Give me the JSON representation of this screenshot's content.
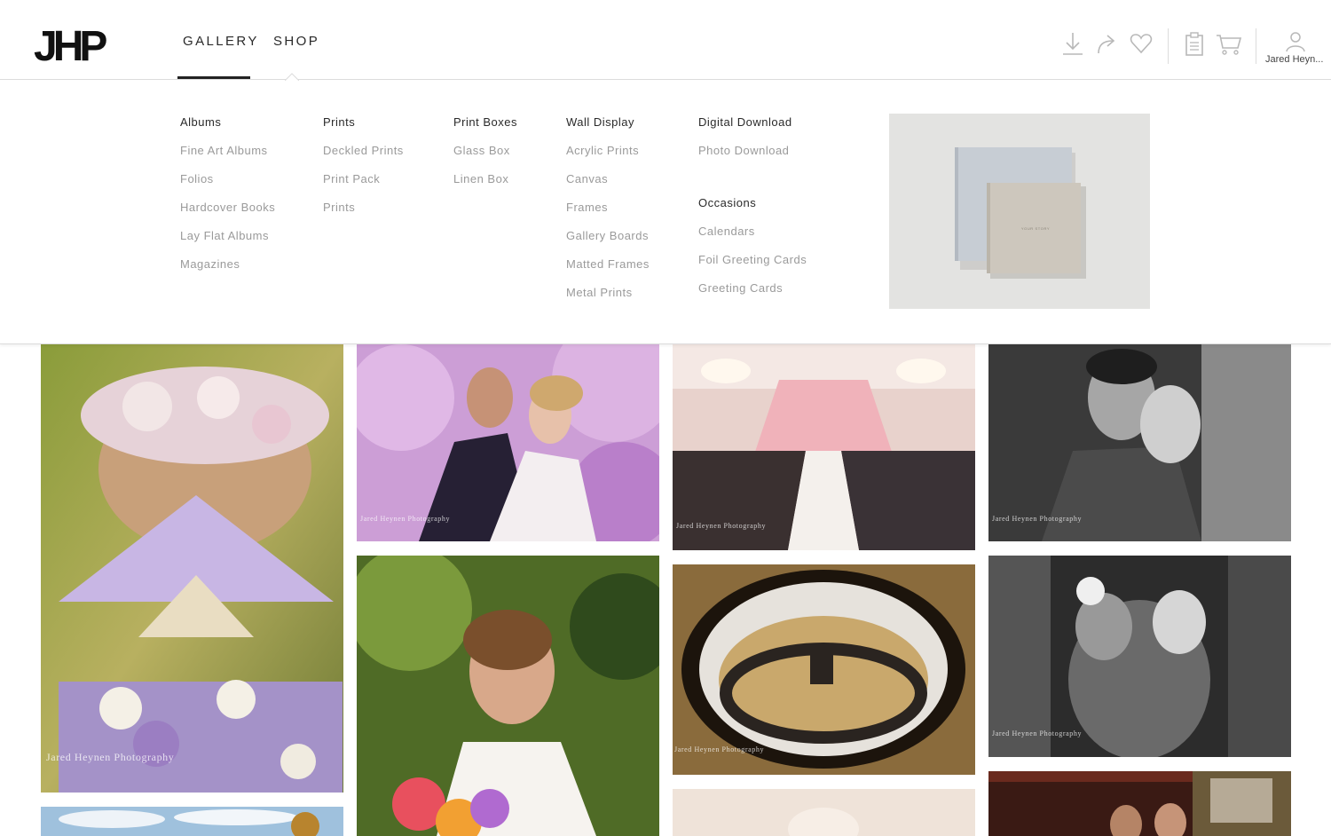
{
  "brand": {
    "logo_text": "JHP"
  },
  "nav": {
    "gallery_label": "GALLERY",
    "shop_label": "SHOP"
  },
  "toolbar": {
    "download_icon": "download-icon",
    "share_icon": "share-icon",
    "favorite_icon": "heart-icon",
    "clipboard_icon": "clipboard-icon",
    "cart_icon": "cart-icon",
    "user_icon": "user-icon",
    "user_name": "Jared Heyn..."
  },
  "menu": {
    "columns": [
      {
        "title": "Albums",
        "items": [
          "Fine Art Albums",
          "Folios",
          "Hardcover Books",
          "Lay Flat Albums",
          "Magazines"
        ]
      },
      {
        "title": "Prints",
        "items": [
          "Deckled Prints",
          "Print Pack",
          "Prints"
        ]
      },
      {
        "title": "Print Boxes",
        "items": [
          "Glass Box",
          "Linen Box"
        ]
      },
      {
        "title": "Wall Display",
        "items": [
          "Acrylic Prints",
          "Canvas",
          "Frames",
          "Gallery Boards",
          "Matted Frames",
          "Metal Prints"
        ]
      },
      {
        "title": "Digital Download",
        "items": [
          "Photo Download"
        ]
      },
      {
        "title": "Occasions",
        "items": [
          "Calendars",
          "Foil Greeting Cards",
          "Greeting Cards"
        ]
      }
    ],
    "promo_book_text": "YOUR STORY"
  },
  "watermark": "Jared Heynen Photography",
  "colors": {
    "text": "#2a2a2a",
    "muted": "#9a9a9a",
    "divider": "#dcdcdc",
    "promo_bg": "#e3e3e1"
  }
}
